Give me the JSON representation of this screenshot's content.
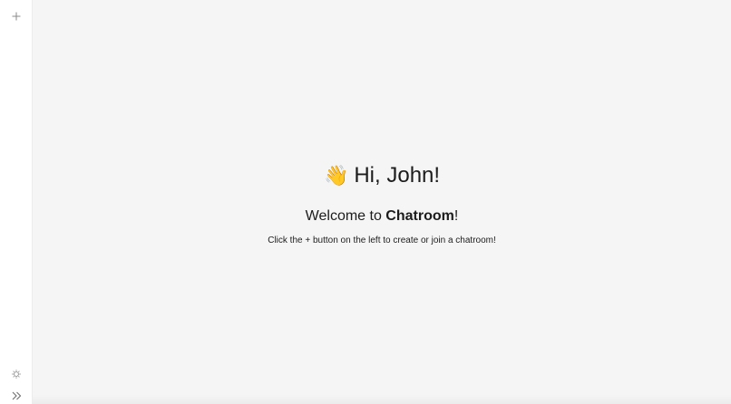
{
  "sidebar": {
    "add_icon": "plus-icon",
    "theme_icon": "sun-icon",
    "expand_icon": "chevrons-right-icon"
  },
  "welcome": {
    "wave_emoji": "👋",
    "greeting": "Hi, John!",
    "subtitle_prefix": "Welcome to ",
    "subtitle_brand": "Chatroom",
    "subtitle_suffix": "!",
    "hint": "Click the + button on the left to create or join a chatroom!"
  },
  "colors": {
    "sidebar_bg": "#ffffff",
    "main_bg": "#f5f5f5",
    "icon": "#8a8a8a",
    "text": "#1c1c1c"
  }
}
